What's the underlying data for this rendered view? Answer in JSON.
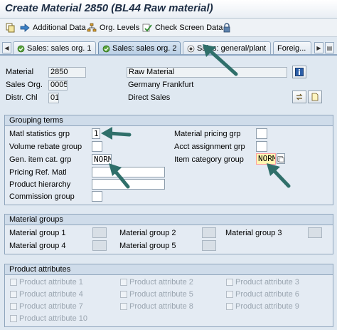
{
  "title": "Create Material 2850 (BL44 Raw material)",
  "toolbar": {
    "additional_data": "Additional Data",
    "org_levels": "Org. Levels",
    "check_screen_data": "Check Screen Data"
  },
  "tabs": [
    {
      "label": "Sales: sales org. 1"
    },
    {
      "label": "Sales: sales org. 2"
    },
    {
      "label": "Sales: general/plant"
    },
    {
      "label": "Foreig..."
    }
  ],
  "header": {
    "material_label": "Material",
    "material_value": "2850",
    "material_desc": "Raw Material",
    "sales_org_label": "Sales Org.",
    "sales_org_value": "0005",
    "sales_org_desc": "Germany Frankfurt",
    "distr_chl_label": "Distr. Chl",
    "distr_chl_value": "01",
    "distr_chl_desc": "Direct Sales"
  },
  "grouping": {
    "title": "Grouping terms",
    "matl_statistics_grp_label": "Matl statistics grp",
    "matl_statistics_grp_value": "1",
    "volume_rebate_group_label": "Volume rebate group",
    "gen_item_cat_grp_label": "Gen. item cat. grp",
    "gen_item_cat_grp_value": "NORM",
    "pricing_ref_matl_label": "Pricing Ref. Matl",
    "product_hierarchy_label": "Product hierarchy",
    "commission_group_label": "Commission group",
    "material_pricing_grp_label": "Material pricing grp",
    "acct_assignment_grp_label": "Acct assignment grp",
    "item_category_group_label": "Item category group",
    "item_category_group_value": "NORM"
  },
  "material_groups": {
    "title": "Material groups",
    "g1": "Material group 1",
    "g2": "Material group 2",
    "g3": "Material group 3",
    "g4": "Material group 4",
    "g5": "Material group 5"
  },
  "product_attributes": {
    "title": "Product attributes",
    "a1": "Product attribute 1",
    "a2": "Product attribute 2",
    "a3": "Product attribute 3",
    "a4": "Product attribute 4",
    "a5": "Product attribute 5",
    "a6": "Product attribute 6",
    "a7": "Product attribute 7",
    "a8": "Product attribute 8",
    "a9": "Product attribute 9",
    "a10": "Product attribute 10"
  },
  "icons": {
    "copy": "copy-icon",
    "arrow_right": "arrow-right-icon",
    "hierarchy": "org-levels-icon",
    "check": "check-icon",
    "lock": "lock-icon",
    "info": "info-icon",
    "callout": "callout-arrow"
  },
  "colors": {
    "callout_arrow": "#2f6f6a",
    "title_text": "#1d2d44",
    "required_bg": "#fff6b0"
  }
}
